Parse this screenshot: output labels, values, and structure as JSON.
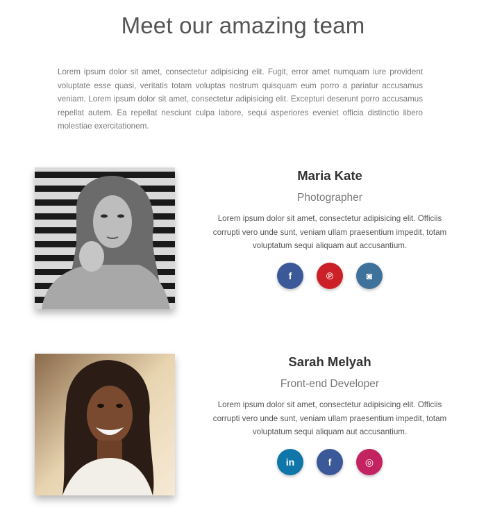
{
  "page": {
    "title": "Meet our amazing team",
    "intro": "Lorem ipsum dolor sit amet, consectetur adipisicing elit. Fugit, error amet numquam iure provident voluptate esse quasi, veritatis totam voluptas nostrum quisquam eum porro a pariatur accusamus veniam. Lorem ipsum dolor sit amet, consectetur adipisicing elit. Excepturi deserunt porro accusamus repellat autem. Ea repellat nesciunt culpa labore, sequi asperiores eveniet officia distinctio libero molestiae exercitationem."
  },
  "team": [
    {
      "name": "Maria Kate",
      "role": "Photographer",
      "bio": "Lorem ipsum dolor sit amet, consectetur adipisicing elit. Officiis corrupti vero unde sunt, veniam ullam praesentium impedit, totam voluptatum sequi aliquam aut accusantium.",
      "socials": [
        {
          "icon": "facebook-icon",
          "glyph": "f",
          "color": "#3b5998"
        },
        {
          "icon": "pinterest-icon",
          "glyph": "℗",
          "color": "#cb2027"
        },
        {
          "icon": "instagram-icon",
          "glyph": "◙",
          "color": "#3f729b"
        }
      ]
    },
    {
      "name": "Sarah Melyah",
      "role": "Front-end Developer",
      "bio": "Lorem ipsum dolor sit amet, consectetur adipisicing elit. Officiis corrupti vero unde sunt, veniam ullam praesentium impedit, totam voluptatum sequi aliquam aut accusantium.",
      "socials": [
        {
          "icon": "linkedin-icon",
          "glyph": "in",
          "color": "#0e76a8"
        },
        {
          "icon": "facebook-icon",
          "glyph": "f",
          "color": "#3b5998"
        },
        {
          "icon": "dribbble-icon",
          "glyph": "◎",
          "color": "#c32361"
        }
      ]
    }
  ]
}
